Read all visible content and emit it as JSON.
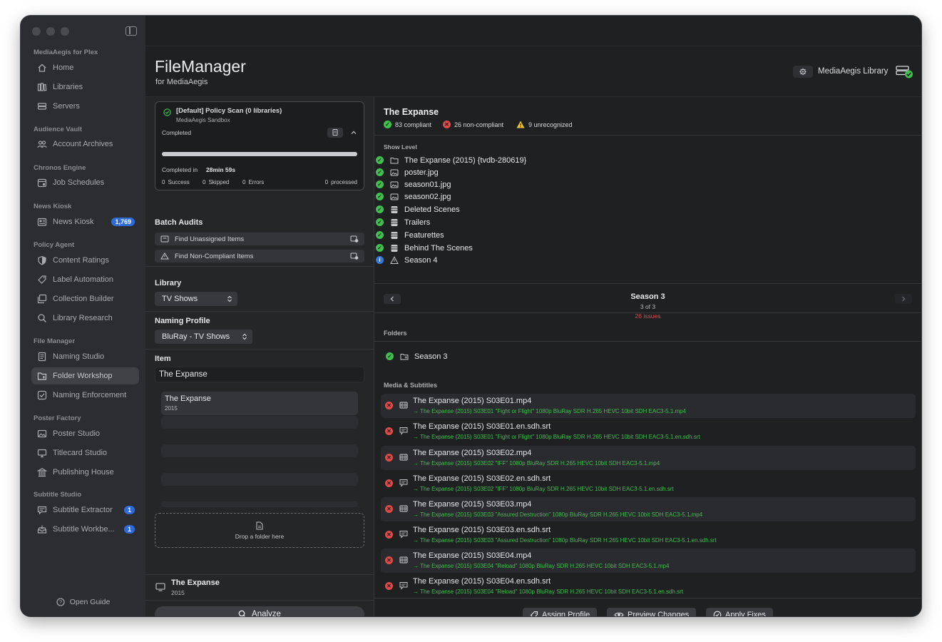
{
  "sidebar": {
    "sections": [
      {
        "title": "MediaAegis for Plex",
        "items": [
          {
            "label": "Home",
            "icon": "house-icon"
          },
          {
            "label": "Libraries",
            "icon": "books-icon"
          },
          {
            "label": "Servers",
            "icon": "server-icon"
          }
        ]
      },
      {
        "title": "Audience Vault",
        "items": [
          {
            "label": "Account Archives",
            "icon": "people-icon"
          }
        ]
      },
      {
        "title": "Chronos Engine",
        "items": [
          {
            "label": "Job Schedules",
            "icon": "calendar-icon"
          }
        ]
      },
      {
        "title": "News Kiosk",
        "items": [
          {
            "label": "News Kiosk",
            "icon": "newspaper-icon",
            "badge": "1,769"
          }
        ]
      },
      {
        "title": "Policy Agent",
        "items": [
          {
            "label": "Content Ratings",
            "icon": "shield-icon"
          },
          {
            "label": "Label Automation",
            "icon": "tag-icon"
          },
          {
            "label": "Collection Builder",
            "icon": "collection-icon"
          },
          {
            "label": "Library Research",
            "icon": "magnifier-icon"
          }
        ]
      },
      {
        "title": "File Manager",
        "items": [
          {
            "label": "Naming Studio",
            "icon": "document-icon"
          },
          {
            "label": "Folder Workshop",
            "icon": "folder-icon",
            "active": true
          },
          {
            "label": "Naming Enforcement",
            "icon": "checkbox-icon"
          }
        ]
      },
      {
        "title": "Poster Factory",
        "items": [
          {
            "label": "Poster Studio",
            "icon": "photo-icon"
          },
          {
            "label": "Titlecard Studio",
            "icon": "display-icon"
          },
          {
            "label": "Publishing House",
            "icon": "building-icon"
          }
        ]
      },
      {
        "title": "Subtitle Studio",
        "items": [
          {
            "label": "Subtitle Extractor",
            "icon": "caption-icon",
            "badge": "1"
          },
          {
            "label": "Subtitle Workbe...",
            "icon": "tray-icon",
            "badge": "1"
          }
        ]
      }
    ],
    "guide_label": "Open Guide"
  },
  "header": {
    "title": "FileManager",
    "subtitle": "for MediaAegis",
    "library_name": "MediaAegis Library"
  },
  "scan": {
    "title": "[Default] Policy Scan (0 libraries)",
    "subtitle": "MediaAegis Sandbox",
    "status": "Completed",
    "progress": 1.0,
    "completed_in_label": "Completed in",
    "duration": "28min 59s",
    "success_count": "0",
    "success_label": "Success",
    "skipped_count": "0",
    "skipped_label": "Skipped",
    "errors_count": "0",
    "errors_label": "Errors",
    "processed_count": "0",
    "processed_label": "processed"
  },
  "batch_audits": {
    "heading": "Batch Audits",
    "buttons": [
      "Find Unassigned Items",
      "Find Non-Compliant Items"
    ]
  },
  "library": {
    "heading": "Library",
    "selected": "TV Shows"
  },
  "naming_profile": {
    "heading": "Naming Profile",
    "selected": "BluRay - TV Shows"
  },
  "item": {
    "heading": "Item",
    "query": "The Expanse",
    "results": [
      {
        "title": "The Expanse",
        "year": "2015"
      }
    ]
  },
  "dropzone": {
    "label": "Drop a folder here"
  },
  "selected_item": {
    "title": "The Expanse",
    "year": "2015"
  },
  "analyze_label": "Analyze",
  "detail": {
    "title": "The Expanse",
    "compliant": "83 compliant",
    "noncompliant": "26 non-compliant",
    "unrecognized": "9 unrecognized",
    "show_level_heading": "Show Level",
    "show_level": [
      {
        "name": "The Expanse (2015) {tvdb-280619}",
        "status": "ok",
        "icon": "folder-icon"
      },
      {
        "name": "poster.jpg",
        "status": "ok",
        "icon": "photo-icon"
      },
      {
        "name": "season01.jpg",
        "status": "ok",
        "icon": "photo-icon"
      },
      {
        "name": "season02.jpg",
        "status": "ok",
        "icon": "photo-icon"
      },
      {
        "name": "Deleted Scenes",
        "status": "ok",
        "icon": "film-folder-icon"
      },
      {
        "name": "Trailers",
        "status": "ok",
        "icon": "film-folder-icon"
      },
      {
        "name": "Featurettes",
        "status": "ok",
        "icon": "film-folder-icon"
      },
      {
        "name": "Behind The Scenes",
        "status": "ok",
        "icon": "film-folder-icon"
      },
      {
        "name": "Season 4",
        "status": "info",
        "icon": "warning-icon"
      }
    ],
    "season": {
      "title": "Season 3",
      "position": "3 of 3",
      "issues": "26 issues"
    },
    "folders_heading": "Folders",
    "folders": [
      {
        "name": "Season 3",
        "status": "ok"
      }
    ],
    "media_heading": "Media & Subtitles",
    "media": [
      {
        "name": "The Expanse (2015) S03E01.mp4",
        "rename": "→ The Expanse (2015) S03E01 \"Fight or Flight\" 1080p BluRay SDR H.265 HEVC 10bit SDH EAC3-5.1.mp4",
        "kind": "video"
      },
      {
        "name": "The Expanse (2015) S03E01.en.sdh.srt",
        "rename": "→ The Expanse (2015) S03E01 \"Fight or Flight\" 1080p BluRay SDR H.265 HEVC 10bit SDH EAC3-5.1.en.sdh.srt",
        "kind": "subtitle"
      },
      {
        "name": "The Expanse (2015) S03E02.mp4",
        "rename": "→ The Expanse (2015) S03E02 \"IFF\" 1080p BluRay SDR H.265 HEVC 10bit SDH EAC3-5.1.mp4",
        "kind": "video"
      },
      {
        "name": "The Expanse (2015) S03E02.en.sdh.srt",
        "rename": "→ The Expanse (2015) S03E02 \"IFF\" 1080p BluRay SDR H.265 HEVC 10bit SDH EAC3-5.1.en.sdh.srt",
        "kind": "subtitle"
      },
      {
        "name": "The Expanse (2015) S03E03.mp4",
        "rename": "→ The Expanse (2015) S03E03 \"Assured Destruction\" 1080p BluRay SDR H.265 HEVC 10bit SDH EAC3-5.1.mp4",
        "kind": "video"
      },
      {
        "name": "The Expanse (2015) S03E03.en.sdh.srt",
        "rename": "→ The Expanse (2015) S03E03 \"Assured Destruction\" 1080p BluRay SDR H.265 HEVC 10bit SDH EAC3-5.1.en.sdh.srt",
        "kind": "subtitle"
      },
      {
        "name": "The Expanse (2015) S03E04.mp4",
        "rename": "→ The Expanse (2015) S03E04 \"Reload\" 1080p BluRay SDR H.265 HEVC 10bit SDH EAC3-5.1.mp4",
        "kind": "video"
      },
      {
        "name": "The Expanse (2015) S03E04.en.sdh.srt",
        "rename": "→ The Expanse (2015) S03E04 \"Reload\" 1080p BluRay SDR H.265 HEVC 10bit SDH EAC3-5.1.en.sdh.srt",
        "kind": "subtitle"
      }
    ]
  },
  "actions": {
    "assign": "Assign Profile",
    "preview": "Preview Changes",
    "apply": "Apply Fixes"
  },
  "colors": {
    "ok": "#3fbf4e",
    "error": "#e04a4a",
    "info": "#3378e0",
    "warning": "#f2c12e",
    "accent": "#2f6bd8"
  }
}
